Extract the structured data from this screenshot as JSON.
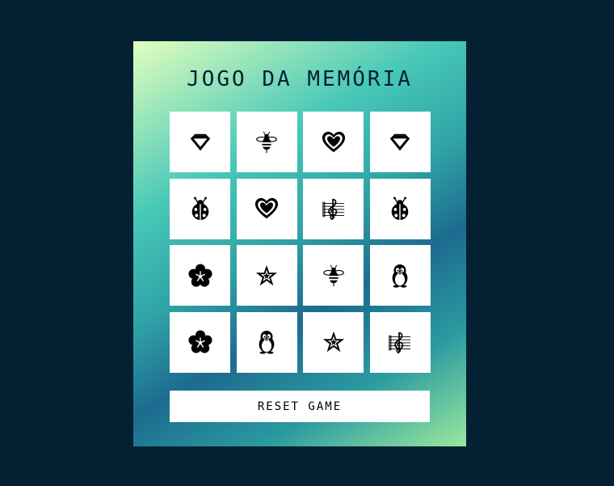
{
  "game": {
    "title": "JOGO DA MEMÓRIA",
    "reset_label": "RESET GAME",
    "cards": [
      {
        "icon": "diamond-icon"
      },
      {
        "icon": "bee-icon"
      },
      {
        "icon": "heart-icon"
      },
      {
        "icon": "diamond-icon"
      },
      {
        "icon": "ladybug-icon"
      },
      {
        "icon": "heart-icon"
      },
      {
        "icon": "music-staff-icon"
      },
      {
        "icon": "ladybug-icon"
      },
      {
        "icon": "flower-icon"
      },
      {
        "icon": "star-icon"
      },
      {
        "icon": "bee-icon"
      },
      {
        "icon": "penguin-icon"
      },
      {
        "icon": "flower-icon"
      },
      {
        "icon": "penguin-icon"
      },
      {
        "icon": "star-icon"
      },
      {
        "icon": "music-staff-icon"
      }
    ]
  },
  "colors": {
    "page_background": "#032133",
    "card_face": "#ffffff",
    "title_text": "#032133"
  }
}
